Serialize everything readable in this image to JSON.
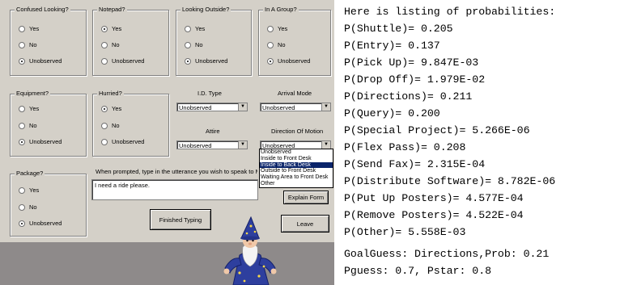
{
  "form": {
    "groups": {
      "confused": {
        "title": "Confused Looking?",
        "options": [
          "Yes",
          "No",
          "Unobserved"
        ],
        "selected": 2
      },
      "notepad": {
        "title": "Notepad?",
        "options": [
          "Yes",
          "No",
          "Unobserved"
        ],
        "selected": 0
      },
      "looking_outside": {
        "title": "Looking Outside?",
        "options": [
          "Yes",
          "No",
          "Unobserved"
        ],
        "selected": 2
      },
      "in_a_group": {
        "title": "In A Group?",
        "options": [
          "Yes",
          "No",
          "Unobserved"
        ],
        "selected": 2
      },
      "equipment": {
        "title": "Equipment?",
        "options": [
          "Yes",
          "No",
          "Unobserved"
        ],
        "selected": 2
      },
      "hurried": {
        "title": "Hurried?",
        "options": [
          "Yes",
          "No",
          "Unobserved"
        ],
        "selected": 0
      },
      "package": {
        "title": "Package?",
        "options": [
          "Yes",
          "No",
          "Unobserved"
        ],
        "selected": 2
      }
    },
    "id_type": {
      "label": "I.D. Type",
      "value": "Unobserved"
    },
    "arrival_mode": {
      "label": "Arrival Mode",
      "value": "Unobserved"
    },
    "attire": {
      "label": "Attire",
      "value": "Unobserved"
    },
    "direction_of_motion": {
      "label": "Direction Of Motion",
      "value": "Unobserved",
      "options": [
        "Unobserved",
        "Inside to Front Desk",
        "Inside to Back Desk",
        "Outside to Front Desk",
        "Waiting Area to Front Desk",
        "Other"
      ],
      "highlighted": 2
    },
    "prompt": "When prompted, type in the utterance you wish to speak to Merlin.",
    "utterance": "I need a ride please.",
    "buttons": {
      "explain": "Explain Form",
      "finished": "Finished Typing",
      "leave": "Leave"
    }
  },
  "listing": {
    "header": "Here is listing of probabilities:",
    "lines": [
      "P(Shuttle)= 0.205",
      "P(Entry)= 0.137",
      "P(Pick Up)= 9.847E-03",
      "P(Drop Off)= 1.979E-02",
      "P(Directions)= 0.211",
      "P(Query)= 0.200",
      "P(Special Project)= 5.266E-06",
      "P(Flex Pass)= 0.208",
      "P(Send Fax)= 2.315E-04",
      "P(Distribute Software)= 8.782E-06",
      "P(Put Up Posters)= 4.577E-04",
      "P(Remove Posters)= 4.522E-04",
      "P(Other)= 5.558E-03"
    ],
    "goal_guess": "GoalGuess: Directions,Prob: 0.21",
    "pguess": "Pguess: 0.7, Pstar: 0.8"
  }
}
